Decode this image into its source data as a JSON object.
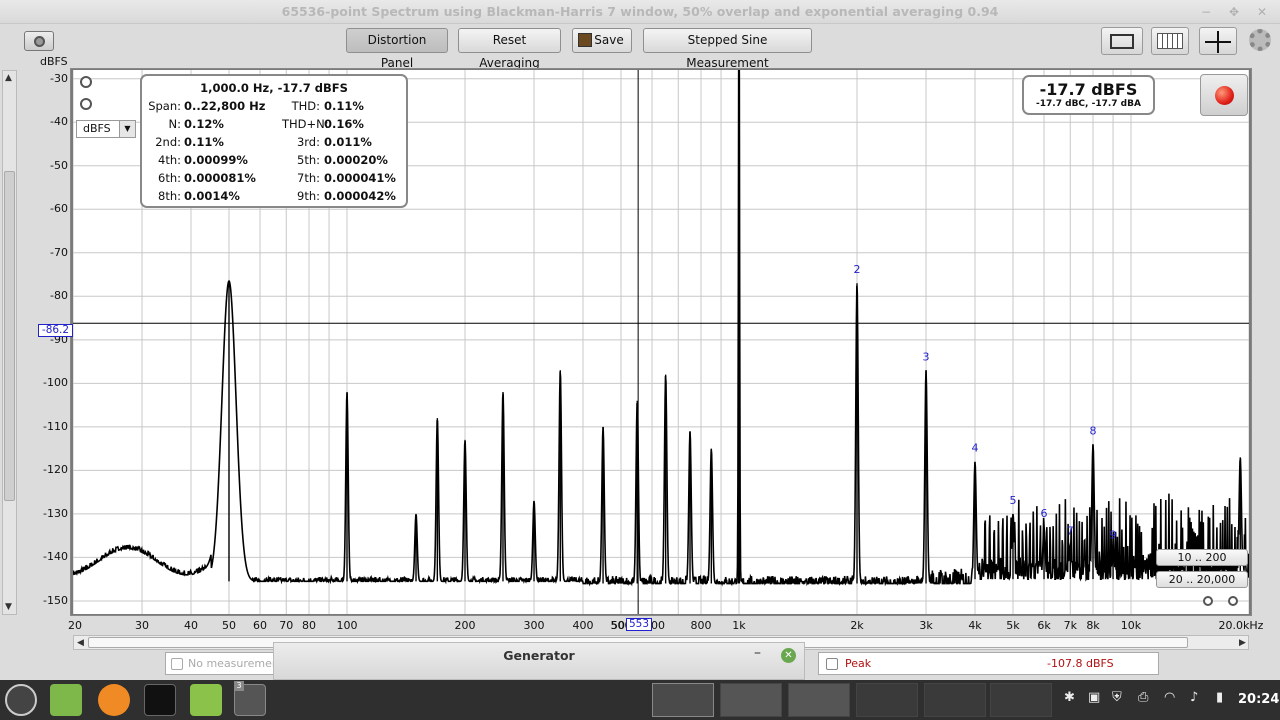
{
  "window": {
    "title": "65536-point Spectrum using Blackman-Harris 7 window, 50% overlap and exponential averaging 0.94",
    "minimize": "−",
    "maximize": "✥",
    "close": "✕"
  },
  "toolbar": {
    "distortion_panel": "Distortion Panel",
    "reset_averaging": "Reset Averaging",
    "save": "Save",
    "stepped_sine": "Stepped Sine Measurement"
  },
  "y_axis": {
    "label": "dBFS",
    "ticks": [
      "-30",
      "-40",
      "-50",
      "-60",
      "-70",
      "-80",
      "-90",
      "-100",
      "-110",
      "-120",
      "-130",
      "-140",
      "-150"
    ]
  },
  "x_axis": {
    "ticks": [
      "20",
      "30",
      "40",
      "50",
      "60",
      "70",
      "80",
      "100",
      "200",
      "300",
      "400",
      "500",
      "800",
      "1k",
      "2k",
      "3k",
      "4k",
      "5k",
      "6k",
      "7k",
      "8k",
      "10k",
      "20.0kHz"
    ]
  },
  "unit_selector": {
    "value": "dBFS"
  },
  "cursor": {
    "y_value": "-86.2",
    "x_value": "553",
    "x_prefix": "50",
    "x_suffix": "00"
  },
  "distortion": {
    "header": "1,000.0 Hz, -17.7 dBFS",
    "rows": [
      {
        "k1": "Span:",
        "v1": "0..22,800 Hz",
        "k2": "THD:",
        "v2": "0.11%"
      },
      {
        "k1": "N:",
        "v1": "0.12%",
        "k2": "THD+N:",
        "v2": "0.16%"
      },
      {
        "k1": "2nd:",
        "v1": "0.11%",
        "k2": "3rd:",
        "v2": "0.011%"
      },
      {
        "k1": "4th:",
        "v1": "0.00099%",
        "k2": "5th:",
        "v2": "0.00020%"
      },
      {
        "k1": "6th:",
        "v1": "0.000081%",
        "k2": "7th:",
        "v2": "0.000041%"
      },
      {
        "k1": "8th:",
        "v1": "0.0014%",
        "k2": "9th:",
        "v2": "0.000042%"
      }
    ]
  },
  "readout": {
    "main": "-17.7 dBFS",
    "sub": "-17.7 dBC, -17.7 dBA"
  },
  "ranges": {
    "r1": "10 .. 200",
    "r2": "20 .. 20,000"
  },
  "status": {
    "no_meas": "No measurements",
    "peak_label": "Peak",
    "peak_value": "-107.8 dBFS"
  },
  "generator": {
    "title": "Generator"
  },
  "taskbar": {
    "badge": "3",
    "clock": "20:24"
  },
  "chart_data": {
    "type": "line",
    "xlabel": "",
    "ylabel": "dBFS",
    "x_scale": "log",
    "xlim": [
      20,
      20000
    ],
    "ylim": [
      -153,
      -28
    ],
    "grid": true,
    "peaks": [
      {
        "f": 50,
        "db": -76.5
      },
      {
        "f": 100,
        "db": -102
      },
      {
        "f": 150,
        "db": -130
      },
      {
        "f": 170,
        "db": -108
      },
      {
        "f": 200,
        "db": -113
      },
      {
        "f": 250,
        "db": -102
      },
      {
        "f": 300,
        "db": -127
      },
      {
        "f": 350,
        "db": -97
      },
      {
        "f": 450,
        "db": -110
      },
      {
        "f": 550,
        "db": -104
      },
      {
        "f": 650,
        "db": -98
      },
      {
        "f": 750,
        "db": -111
      },
      {
        "f": 850,
        "db": -115
      },
      {
        "f": 1000,
        "db": -17.7
      },
      {
        "f": 2000,
        "db": -77
      },
      {
        "f": 3000,
        "db": -97
      },
      {
        "f": 4000,
        "db": -118
      },
      {
        "f": 5000,
        "db": -130
      },
      {
        "f": 6000,
        "db": -133
      },
      {
        "f": 7000,
        "db": -137
      },
      {
        "f": 8000,
        "db": -114
      },
      {
        "f": 9000,
        "db": -138
      },
      {
        "f": 19000,
        "db": -117
      }
    ],
    "harmonic_labels": [
      {
        "label": "2",
        "f": 2000,
        "db": -77
      },
      {
        "label": "3",
        "f": 3000,
        "db": -97
      },
      {
        "label": "4",
        "f": 4000,
        "db": -118
      },
      {
        "label": "5",
        "f": 5000,
        "db": -130
      },
      {
        "label": "6",
        "f": 6000,
        "db": -133
      },
      {
        "label": "7",
        "f": 7000,
        "db": -137
      },
      {
        "label": "8",
        "f": 8000,
        "db": -114
      },
      {
        "label": "9",
        "f": 9000,
        "db": -138
      }
    ],
    "cursor": {
      "f": 553,
      "db": -86.2
    }
  }
}
